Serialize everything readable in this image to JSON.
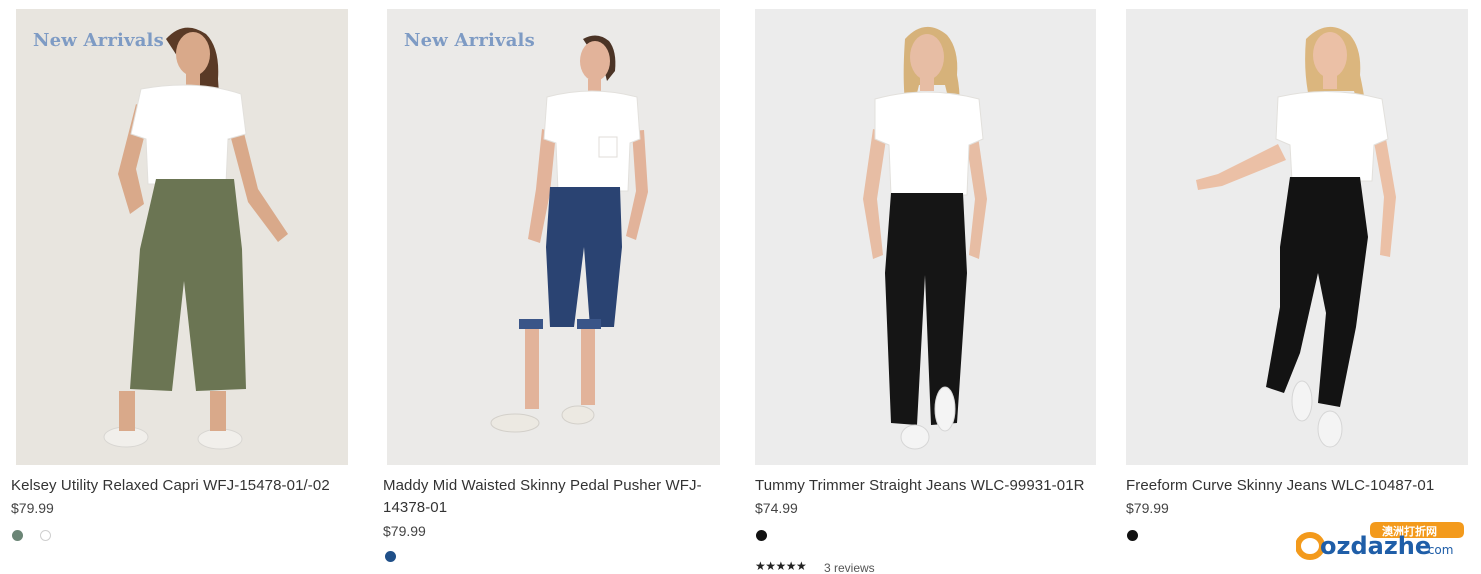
{
  "products": [
    {
      "badge": "New Arrivals",
      "name": "Kelsey Utility Relaxed Capri WFJ-15478-01/-02",
      "price": "$79.99",
      "swatches": [
        "#6b8576",
        "#ffffff"
      ],
      "image": {
        "bg": "#e8e5df",
        "top": "#ffffff",
        "bottom": "#6b7553",
        "skin": "#d9a98a",
        "hair": "#5a3a26",
        "shoe": "#f1efeb"
      }
    },
    {
      "badge": "New Arrivals",
      "name": "Maddy Mid Waisted Skinny Pedal Pusher WFJ-14378-01",
      "price": "$79.99",
      "swatches": [
        "#1f4f88"
      ],
      "image": {
        "bg": "#ebeae8",
        "top": "#ffffff",
        "bottom": "#2a4372",
        "skin": "#e2b39a",
        "hair": "#4b3426",
        "shoe": "#ece9e2"
      }
    },
    {
      "name": "Tummy Trimmer Straight Jeans WLC-99931-01R",
      "price": "$74.99",
      "swatches": [
        "#111111"
      ],
      "rating_stars": "★★★★★",
      "reviews": "3 reviews",
      "image": {
        "bg": "#ececec",
        "top": "#ffffff",
        "bottom": "#151515",
        "skin": "#e7bda4",
        "hair": "#d6b27a",
        "shoe": "#f4f4f4"
      }
    },
    {
      "name": "Freeform Curve Skinny Jeans WLC-10487-01",
      "price": "$79.99",
      "swatches": [
        "#111111"
      ],
      "image": {
        "bg": "#ececec",
        "top": "#ffffff",
        "bottom": "#131313",
        "skin": "#ebc0a6",
        "hair": "#dbb67e",
        "shoe": "#f4f4f4"
      }
    }
  ],
  "watermark": {
    "brand": "ozdazhe",
    "domain": ".com",
    "chinese": "澳洲打折网",
    "orange": "#f39a1c",
    "blue": "#1f5ea8"
  }
}
